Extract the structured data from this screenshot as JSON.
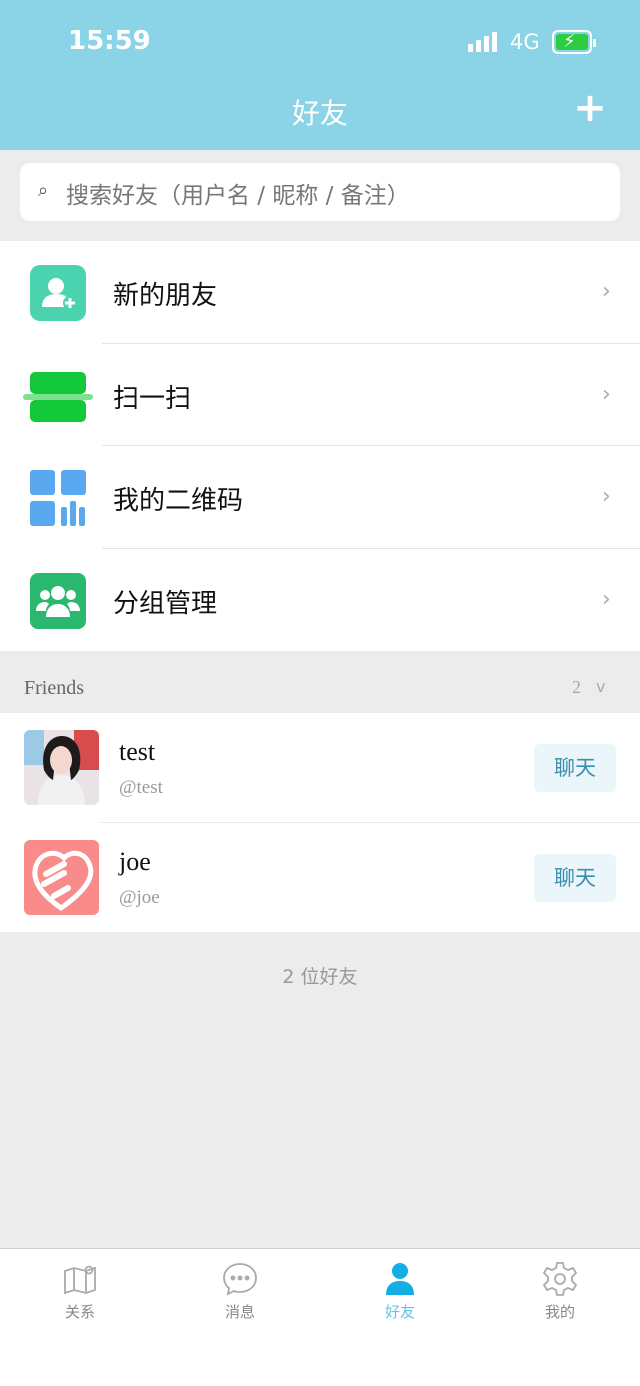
{
  "status_bar": {
    "time": "15:59",
    "network": "4G"
  },
  "header": {
    "title": "好友",
    "add_icon": "plus-icon"
  },
  "search": {
    "placeholder": "搜索好友（用户名 / 昵称 / 备注）",
    "icon": "search-icon"
  },
  "menu": [
    {
      "label": "新的朋友",
      "icon": "add-friend-icon",
      "color": "#4bd3b0"
    },
    {
      "label": "扫一扫",
      "icon": "scan-icon",
      "color": "#14c939"
    },
    {
      "label": "我的二维码",
      "icon": "qr-code-icon",
      "color": "#5aa9f0"
    },
    {
      "label": "分组管理",
      "icon": "group-icon",
      "color": "#29b86e"
    }
  ],
  "group": {
    "name": "Friends",
    "count": "2",
    "chevron": "v"
  },
  "friends": [
    {
      "name": "test",
      "username": "@test",
      "action": "聊天",
      "avatar": "photo-avatar"
    },
    {
      "name": "joe",
      "username": "@joe",
      "action": "聊天",
      "avatar": "logo-avatar"
    }
  ],
  "footer": {
    "count_text": "2 位好友"
  },
  "tabs": [
    {
      "label": "关系",
      "icon": "map-icon",
      "active": false
    },
    {
      "label": "消息",
      "icon": "chat-bubble-icon",
      "active": false
    },
    {
      "label": "好友",
      "icon": "person-icon",
      "active": true
    },
    {
      "label": "我的",
      "icon": "gear-icon",
      "active": false
    }
  ],
  "colors": {
    "header_bg": "#8bd3e6",
    "accent": "#5ac8ea",
    "chat_btn_bg": "#ebf6fb"
  }
}
